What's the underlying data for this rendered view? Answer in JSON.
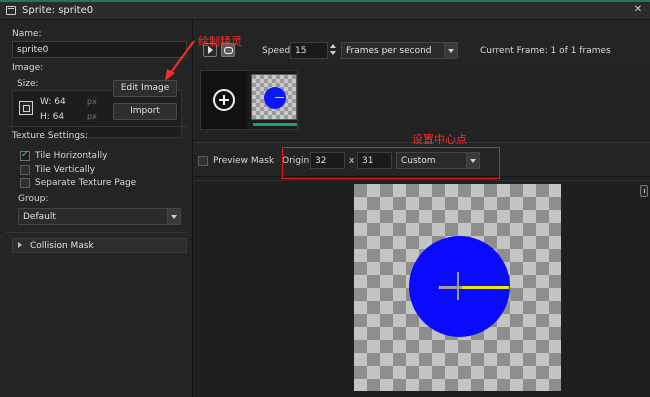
{
  "window": {
    "title": "Sprite: sprite0"
  },
  "left": {
    "name_label": "Name:",
    "name_value": "sprite0",
    "image_label": "Image:",
    "size_label": "Size:",
    "width_text": "W: 64",
    "height_text": "H: 64",
    "unit": "px",
    "edit_image_label": "Edit Image",
    "import_label": "Import",
    "texture_settings_label": "Texture Settings:",
    "tile_horizontally": {
      "label": "Tile Horizontally",
      "checked": true
    },
    "tile_vertically": {
      "label": "Tile Vertically",
      "checked": false
    },
    "separate_texture_page": {
      "label": "Separate Texture Page",
      "checked": false
    },
    "group_label": "Group:",
    "group_value": "Default",
    "collision_mask_label": "Collision Mask"
  },
  "toolbar": {
    "speed_label": "Speed:",
    "speed_value": "15",
    "speed_unit_value": "Frames per second",
    "current_frame_text": "Current Frame: 1 of 1 frames"
  },
  "origin_row": {
    "preview_mask_label": "Preview Mask",
    "origin_label": "Origin:",
    "origin_x": "32",
    "x_sep": "x",
    "origin_y": "31",
    "origin_preset": "Custom"
  },
  "annotations": {
    "draw_sprite": "绘制精灵",
    "set_center": "设置中心点"
  },
  "colors": {
    "accent": "#17a36c",
    "sprite_fill": "#0a0aff",
    "origin_line": "#e8e800",
    "annotation": "#ff2a2a"
  }
}
